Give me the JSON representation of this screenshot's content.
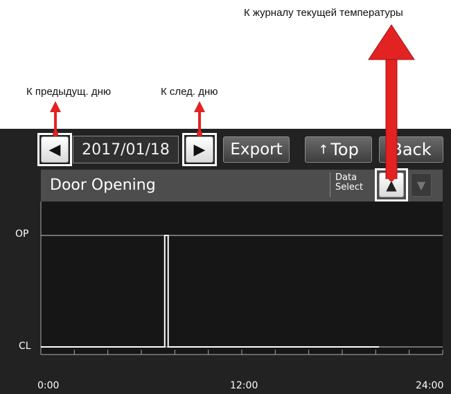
{
  "annotations": {
    "temp_log": "К журналу текущей температуры",
    "prev_day": "К предыдущ. дню",
    "next_day": "К след. дню"
  },
  "toolbar": {
    "date": "2017/01/18",
    "export_label": "Export",
    "top_label": "Top",
    "back_label": "Back"
  },
  "header": {
    "title": "Door Opening",
    "data_select_line1": "Data",
    "data_select_line2": "Select"
  },
  "colors": {
    "arrow": "#e32222",
    "screen_bg": "#222222",
    "trace": "#ffffff"
  },
  "chart_data": {
    "type": "line",
    "y_categories": [
      "CL",
      "OP"
    ],
    "xticks": [
      "0:00",
      "12:00",
      "24:00"
    ],
    "xlim_hours": [
      0,
      24
    ],
    "series": [
      {
        "points": [
          [
            0,
            "CL"
          ],
          [
            7.4,
            "CL"
          ],
          [
            7.4,
            "OP"
          ],
          [
            7.6,
            "OP"
          ],
          [
            7.6,
            "CL"
          ],
          [
            20.2,
            "CL"
          ]
        ]
      }
    ]
  }
}
